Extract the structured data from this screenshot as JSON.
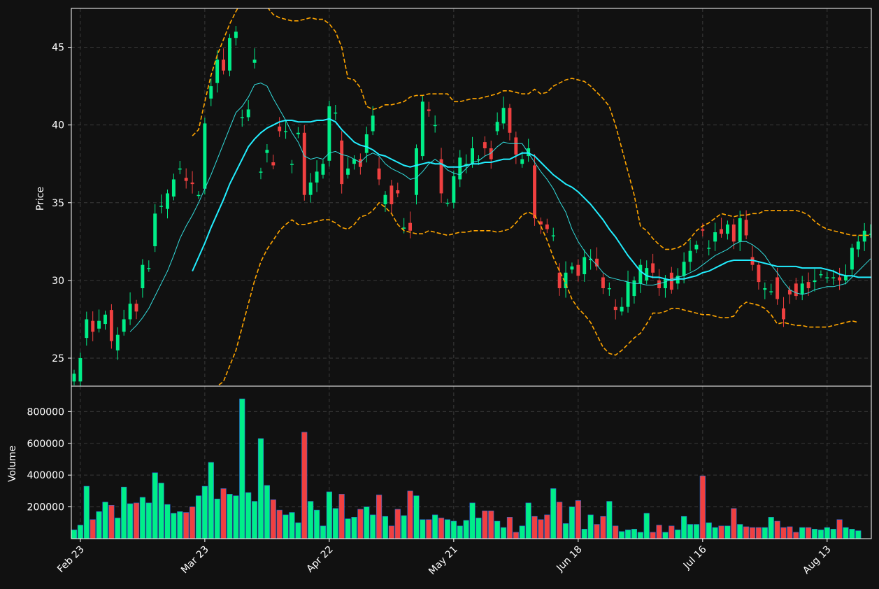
{
  "colors": {
    "background": "#111111",
    "up": "#00ee88",
    "down": "#f04040",
    "sma_fast": "#33dddd",
    "sma_slow": "#22eeff",
    "bollinger": "#ffa500",
    "grid": "#3a3a3a",
    "spine": "#ffffff"
  },
  "chart_data": [
    {
      "type": "candlestick",
      "ylabel": "Price",
      "ylim": [
        23.2,
        47.5
      ],
      "yticks": [
        25,
        30,
        35,
        40,
        45
      ],
      "grid": true,
      "x_tick_labels": [
        "Feb 23",
        "Mar 23",
        "Apr 22",
        "May 21",
        "Jun 18",
        "Jul 16",
        "Aug 13"
      ],
      "x_tick_index": [
        1,
        21,
        41,
        61,
        81,
        101,
        121
      ],
      "close": [
        24.0,
        25.0,
        27.5,
        26.7,
        27.4,
        27.8,
        26.1,
        26.5,
        27.5,
        28.5,
        28.0,
        31.0,
        30.8,
        34.3,
        34.8,
        35.6,
        36.5,
        37.2,
        36.4,
        36.2,
        35.5,
        40.1,
        42.5,
        44.2,
        43.5,
        45.6,
        46.0,
        40.5,
        41.0,
        44.2,
        37.0,
        38.4,
        37.4,
        39.6,
        39.6,
        37.5,
        39.5,
        35.5,
        36.3,
        37.0,
        37.5,
        41.2,
        40.8,
        36.2,
        37.2,
        37.8,
        37.3,
        39.4,
        40.6,
        36.5,
        35.5,
        34.9,
        35.6,
        33.4,
        33.2,
        38.5,
        41.5,
        40.9,
        40.0,
        35.6,
        35.0,
        36.7,
        37.9,
        37.5,
        38.5,
        37.8,
        38.5,
        37.8,
        40.2,
        41.1,
        39.5,
        38.1,
        37.8,
        38.5,
        34.0,
        33.6,
        33.3,
        32.9,
        29.5,
        30.5,
        30.9,
        30.3,
        31.5,
        31.4,
        30.9,
        29.5,
        29.5,
        28.1,
        28.3,
        29.9,
        30.0,
        31.0,
        30.8,
        30.5,
        29.5,
        30.1,
        29.4,
        30.3,
        31.2,
        31.9,
        32.3,
        33.2,
        32.1,
        33.1,
        33.0,
        33.6,
        32.5,
        34.0,
        32.9,
        31.0,
        29.9,
        29.5,
        29.3,
        28.8,
        27.5,
        29.1,
        29.0,
        29.8,
        29.5,
        30.0,
        30.4,
        30.2,
        30.2,
        30.0,
        30.3,
        32.1,
        32.5,
        33.2,
        33.0
      ],
      "open": [
        23.5,
        23.5,
        26.3,
        27.4,
        26.9,
        27.2,
        28.1,
        25.5,
        26.7,
        27.5,
        28.5,
        29.5,
        30.8,
        32.2,
        34.8,
        34.6,
        35.4,
        37.2,
        36.6,
        36.3,
        35.5,
        35.9,
        41.7,
        42.7,
        44.2,
        43.5,
        45.6,
        40.5,
        40.5,
        44.0,
        37.0,
        38.2,
        37.6,
        39.9,
        39.6,
        37.5,
        39.4,
        39.5,
        35.5,
        36.3,
        36.8,
        37.7,
        40.8,
        39.0,
        36.8,
        37.5,
        37.8,
        38.2,
        39.6,
        37.2,
        34.9,
        36.1,
        35.8,
        33.4,
        33.7,
        35.5,
        38.0,
        41.0,
        40.0,
        37.8,
        35.0,
        35.0,
        36.5,
        37.5,
        37.5,
        37.8,
        38.9,
        38.5,
        39.6,
        40.1,
        41.1,
        39.2,
        37.5,
        38.0,
        37.4,
        33.8,
        33.6,
        32.9,
        30.5,
        29.5,
        30.7,
        31.0,
        30.4,
        31.3,
        31.4,
        30.2,
        29.5,
        28.3,
        28.0,
        28.3,
        29.0,
        29.8,
        30.0,
        31.1,
        30.0,
        29.5,
        30.5,
        29.8,
        30.3,
        31.2,
        32.0,
        33.3,
        32.1,
        32.5,
        33.3,
        33.0,
        33.6,
        32.5,
        33.9,
        31.5,
        31.0,
        29.4,
        29.3,
        30.2,
        28.2,
        29.4,
        29.8,
        29.1,
        29.9,
        29.9,
        30.4,
        30.2,
        30.2,
        30.2,
        30.0,
        30.7,
        32.0,
        32.5,
        33.0
      ],
      "sma_fast": [
        null,
        null,
        null,
        null,
        null,
        null,
        null,
        null,
        null,
        26.7,
        27.1,
        27.6,
        28.2,
        29.0,
        29.8,
        30.6,
        31.6,
        32.7,
        33.5,
        34.2,
        35.0,
        35.9,
        36.8,
        37.8,
        38.8,
        39.8,
        40.8,
        41.2,
        41.8,
        42.6,
        42.7,
        42.5,
        41.7,
        41.0,
        40.3,
        39.5,
        38.9,
        38.0,
        37.8,
        37.9,
        37.8,
        38.2,
        38.3,
        38.1,
        38.0,
        37.8,
        37.6,
        38.0,
        38.2,
        38.0,
        37.5,
        37.2,
        37.0,
        36.8,
        36.5,
        36.6,
        37.0,
        37.5,
        37.8,
        37.5,
        37.1,
        36.9,
        36.8,
        37.2,
        37.6,
        37.7,
        38.0,
        38.2,
        38.6,
        38.9,
        38.8,
        38.8,
        38.8,
        38.2,
        37.6,
        37.0,
        36.5,
        35.9,
        35.1,
        34.4,
        33.3,
        32.5,
        31.9,
        31.4,
        31.0,
        30.5,
        30.2,
        30.1,
        30.0,
        29.9,
        29.8,
        29.8,
        29.7,
        29.7,
        29.8,
        29.9,
        30.1,
        30.2,
        30.3,
        30.5,
        30.7,
        31.0,
        31.3,
        31.6,
        31.8,
        32.0,
        32.3,
        32.5,
        32.5,
        32.3,
        32.0,
        31.6,
        31.0,
        30.5,
        29.9,
        29.4,
        29.2,
        29.1,
        29.2,
        29.4,
        29.5,
        29.6,
        29.6,
        29.7,
        29.8,
        30.2,
        30.6,
        31.0,
        31.4
      ],
      "sma_slow": [
        null,
        null,
        null,
        null,
        null,
        null,
        null,
        null,
        null,
        null,
        null,
        null,
        null,
        null,
        null,
        null,
        null,
        null,
        null,
        30.6,
        31.5,
        32.4,
        33.4,
        34.3,
        35.2,
        36.2,
        37.0,
        37.8,
        38.6,
        39.1,
        39.5,
        39.8,
        40.0,
        40.2,
        40.3,
        40.3,
        40.2,
        40.2,
        40.2,
        40.3,
        40.3,
        40.4,
        40.2,
        39.7,
        39.3,
        38.9,
        38.7,
        38.6,
        38.4,
        38.1,
        38.0,
        37.8,
        37.6,
        37.4,
        37.3,
        37.4,
        37.5,
        37.6,
        37.5,
        37.5,
        37.3,
        37.3,
        37.3,
        37.4,
        37.5,
        37.5,
        37.6,
        37.6,
        37.7,
        37.8,
        37.8,
        38.0,
        38.2,
        38.2,
        38.0,
        37.6,
        37.2,
        36.8,
        36.5,
        36.2,
        36.0,
        35.7,
        35.3,
        34.9,
        34.4,
        33.9,
        33.3,
        32.8,
        32.2,
        31.6,
        31.1,
        30.6,
        30.3,
        30.2,
        30.2,
        30.1,
        30.0,
        30.1,
        30.1,
        30.2,
        30.3,
        30.5,
        30.6,
        30.8,
        31.0,
        31.2,
        31.3,
        31.3,
        31.3,
        31.3,
        31.2,
        31.1,
        31.0,
        30.9,
        30.9,
        30.9,
        30.9,
        30.8,
        30.8,
        30.8,
        30.8,
        30.7,
        30.6,
        30.4,
        30.3,
        30.3,
        30.2,
        30.2,
        30.2,
        30.2
      ],
      "bb_upper": [
        null,
        null,
        null,
        null,
        null,
        null,
        null,
        null,
        null,
        null,
        null,
        null,
        null,
        null,
        null,
        null,
        null,
        null,
        null,
        39.3,
        39.7,
        41.5,
        43.2,
        44.5,
        45.5,
        46.5,
        47.3,
        48.0,
        48.6,
        48.5,
        48.0,
        47.6,
        47.1,
        46.9,
        46.8,
        46.7,
        46.7,
        46.8,
        46.9,
        46.8,
        46.8,
        46.5,
        46.0,
        45.0,
        43.0,
        42.9,
        42.4,
        41.2,
        41.0,
        41.1,
        41.3,
        41.3,
        41.4,
        41.5,
        41.8,
        41.9,
        41.9,
        42.0,
        42.0,
        42.0,
        42.0,
        41.5,
        41.5,
        41.6,
        41.7,
        41.7,
        41.8,
        41.9,
        42.0,
        42.2,
        42.2,
        42.1,
        42.0,
        42.0,
        42.3,
        42.0,
        42.1,
        42.5,
        42.7,
        42.9,
        43.0,
        42.9,
        42.8,
        42.5,
        42.1,
        41.7,
        41.2,
        40.0,
        38.5,
        37.0,
        35.5,
        33.5,
        33.2,
        32.7,
        32.3,
        32.0,
        32.0,
        32.1,
        32.3,
        32.7,
        33.2,
        33.5,
        33.7,
        34.0,
        34.3,
        34.2,
        34.1,
        34.2,
        34.2,
        34.3,
        34.3,
        34.5,
        34.5,
        34.5,
        34.5,
        34.5,
        34.5,
        34.4,
        34.2,
        33.8,
        33.5,
        33.3,
        33.2,
        33.1,
        33.0,
        32.9,
        32.9,
        32.9,
        32.9
      ],
      "bb_lower": [
        null,
        null,
        null,
        null,
        null,
        null,
        null,
        null,
        null,
        null,
        null,
        null,
        null,
        null,
        null,
        null,
        null,
        null,
        null,
        null,
        null,
        22.0,
        22.3,
        23.2,
        23.5,
        24.5,
        25.5,
        27.0,
        28.5,
        30.0,
        31.2,
        32.0,
        32.6,
        33.2,
        33.6,
        33.9,
        33.6,
        33.6,
        33.7,
        33.8,
        33.9,
        33.9,
        33.7,
        33.4,
        33.3,
        33.6,
        34.1,
        34.2,
        34.5,
        35.0,
        34.7,
        34.3,
        33.6,
        33.2,
        33.1,
        33.0,
        33.0,
        33.2,
        33.1,
        33.0,
        32.9,
        33.0,
        33.1,
        33.1,
        33.2,
        33.2,
        33.2,
        33.2,
        33.1,
        33.2,
        33.3,
        33.7,
        34.2,
        34.4,
        34.2,
        33.5,
        32.6,
        31.5,
        30.6,
        29.8,
        28.8,
        28.2,
        27.8,
        27.3,
        26.5,
        25.7,
        25.3,
        25.2,
        25.5,
        25.9,
        26.3,
        26.6,
        27.2,
        27.9,
        27.9,
        28.0,
        28.2,
        28.2,
        28.1,
        28.0,
        27.9,
        27.8,
        27.8,
        27.7,
        27.6,
        27.6,
        27.7,
        28.3,
        28.6,
        28.5,
        28.4,
        28.2,
        27.8,
        27.2,
        27.3,
        27.2,
        27.1,
        27.1,
        27.0,
        27.0,
        27.0,
        27.0,
        27.1,
        27.2,
        27.3,
        27.4,
        27.3
      ]
    },
    {
      "type": "bar",
      "ylabel": "Volume",
      "ylim": [
        0,
        960000
      ],
      "yticks": [
        200000,
        400000,
        600000,
        800000
      ],
      "grid": true,
      "values": [
        55000,
        85000,
        330000,
        120000,
        170000,
        230000,
        210000,
        130000,
        325000,
        220000,
        225000,
        260000,
        225000,
        415000,
        350000,
        215000,
        160000,
        170000,
        165000,
        200000,
        270000,
        330000,
        480000,
        250000,
        315000,
        280000,
        270000,
        880000,
        290000,
        235000,
        630000,
        335000,
        245000,
        180000,
        150000,
        165000,
        100000,
        670000,
        235000,
        180000,
        80000,
        295000,
        190000,
        280000,
        125000,
        135000,
        185000,
        200000,
        150000,
        275000,
        140000,
        80000,
        185000,
        145000,
        300000,
        270000,
        120000,
        120000,
        150000,
        130000,
        120000,
        110000,
        80000,
        115000,
        225000,
        130000,
        175000,
        175000,
        110000,
        70000,
        135000,
        40000,
        80000,
        225000,
        140000,
        120000,
        150000,
        315000,
        230000,
        95000,
        200000,
        240000,
        60000,
        150000,
        90000,
        140000,
        235000,
        80000,
        45000,
        55000,
        60000,
        40000,
        160000,
        40000,
        85000,
        40000,
        80000,
        55000,
        140000,
        90000,
        90000,
        395000,
        100000,
        70000,
        80000,
        80000,
        190000,
        90000,
        75000,
        70000,
        70000,
        70000,
        135000,
        110000,
        70000,
        75000,
        40000,
        70000,
        70000,
        60000,
        55000,
        70000,
        60000,
        120000,
        70000,
        60000,
        50000
      ]
    }
  ]
}
